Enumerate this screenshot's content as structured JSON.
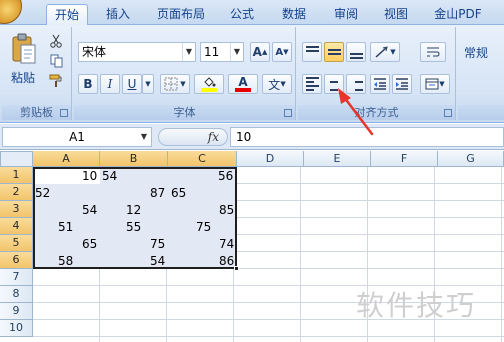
{
  "tabs": [
    {
      "label": "开始",
      "active": true
    },
    {
      "label": "插入"
    },
    {
      "label": "页面布局"
    },
    {
      "label": "公式"
    },
    {
      "label": "数据"
    },
    {
      "label": "审阅"
    },
    {
      "label": "视图"
    },
    {
      "label": "金山PDF"
    }
  ],
  "clipboard": {
    "paste_label": "粘贴",
    "group_label": "剪贴板"
  },
  "font": {
    "name": "宋体",
    "size": "11",
    "grow_glyph": "A",
    "shrink_glyph": "A",
    "bold": "B",
    "italic": "I",
    "underline": "U",
    "font_color_glyph": "A",
    "wen_glyph": "文",
    "group_label": "字体",
    "font_color": "#e60000",
    "fill_color": "#ffff00"
  },
  "alignment": {
    "group_label": "对齐方式"
  },
  "number": {
    "format": "常规"
  },
  "formula_bar": {
    "name_box": "A1",
    "fx": "fx",
    "value": "10"
  },
  "sheet": {
    "columns": [
      "A",
      "B",
      "C",
      "D",
      "E",
      "F",
      "G"
    ],
    "rows": [
      "1",
      "2",
      "3",
      "4",
      "5",
      "6",
      "7",
      "8",
      "9",
      "10"
    ],
    "cells": [
      [
        "10",
        "54",
        "56"
      ],
      [
        "52",
        "87",
        "65"
      ],
      [
        "54",
        "12",
        "85"
      ],
      [
        "51",
        "55",
        "75"
      ],
      [
        "65",
        "75",
        "74"
      ],
      [
        "58",
        "54",
        "86"
      ]
    ]
  },
  "watermark": "软件技巧",
  "colors": {
    "selection_fill": "#e3e8f5",
    "accent_tab": "#ffffff",
    "arrow": "#e8342a"
  }
}
